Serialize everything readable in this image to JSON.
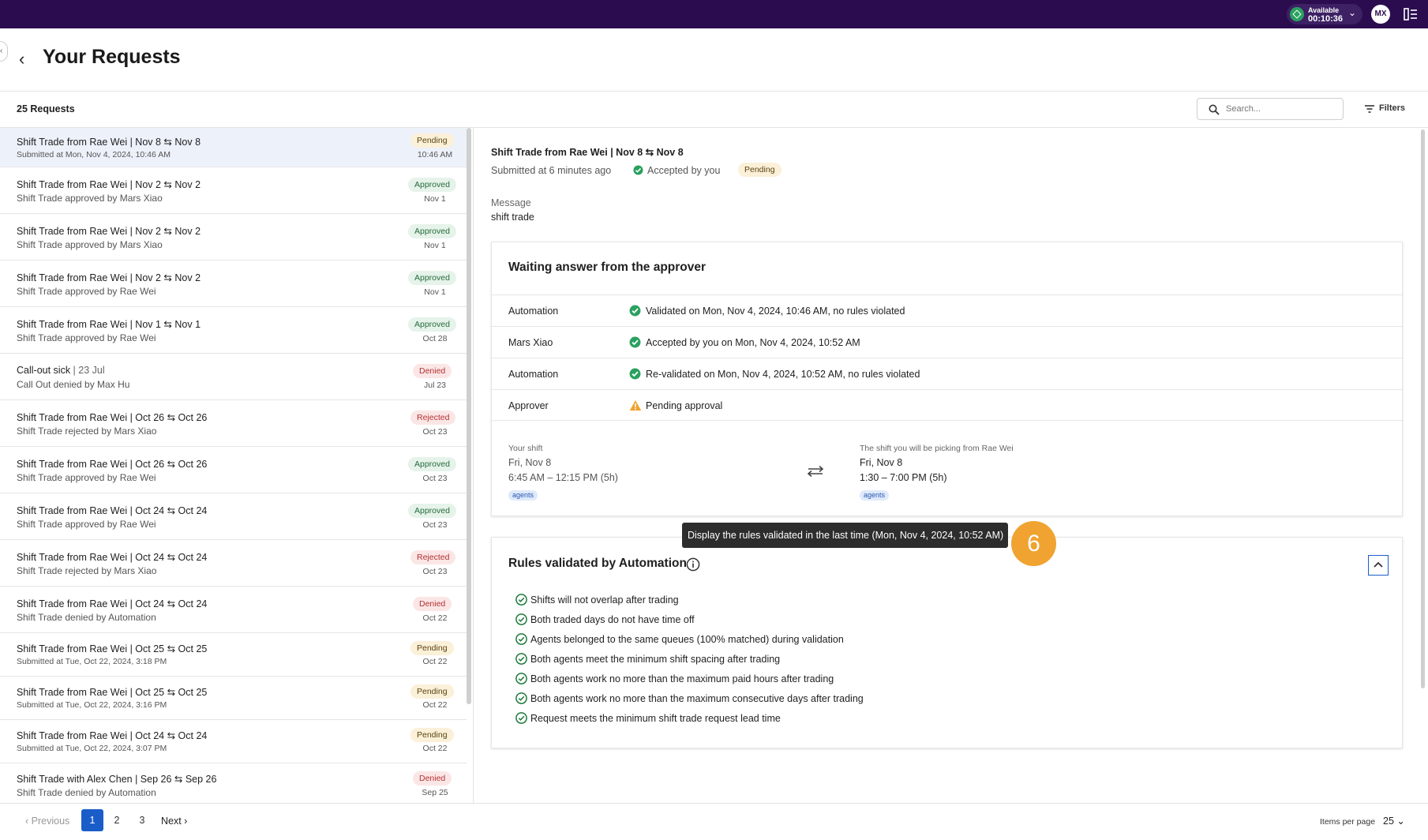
{
  "status": {
    "label": "Available",
    "timer": "00:10:36"
  },
  "user": {
    "initials": "MX"
  },
  "page": {
    "title": "Your Requests"
  },
  "list": {
    "count": "25 Requests",
    "search_placeholder": "Search...",
    "filters_label": "Filters",
    "items": [
      {
        "title": "Shift Trade from Rae Wei | Nov 8 ⇆ Nov 8",
        "subtitle": "Submitted at Mon, Nov 4, 2024, 10:46 AM",
        "status": "Pending",
        "date": "10:46 AM"
      },
      {
        "title": "Shift Trade from Rae Wei | Nov 2 ⇆ Nov 2",
        "subtitle": "Shift Trade approved by Mars Xiao",
        "status": "Approved",
        "date": "Nov 1"
      },
      {
        "title": "Shift Trade from Rae Wei | Nov 2 ⇆ Nov 2",
        "subtitle": "Shift Trade approved by Mars Xiao",
        "status": "Approved",
        "date": "Nov 1"
      },
      {
        "title": "Shift Trade from Rae Wei | Nov 2 ⇆ Nov 2",
        "subtitle": "Shift Trade approved by Rae Wei",
        "status": "Approved",
        "date": "Nov 1"
      },
      {
        "title": "Shift Trade from Rae Wei | Nov 1 ⇆ Nov 1",
        "subtitle": "Shift Trade approved by Rae Wei",
        "status": "Approved",
        "date": "Oct 28"
      },
      {
        "title": "Call-out sick",
        "title_suffix": " | 23 Jul",
        "subtitle": "Call Out denied by Max Hu",
        "status": "Denied",
        "date": "Jul 23"
      },
      {
        "title": "Shift Trade from Rae Wei | Oct 26 ⇆ Oct 26",
        "subtitle": "Shift Trade rejected by Mars Xiao",
        "status": "Rejected",
        "date": "Oct 23"
      },
      {
        "title": "Shift Trade from Rae Wei | Oct 26 ⇆ Oct 26",
        "subtitle": "Shift Trade approved by Rae Wei",
        "status": "Approved",
        "date": "Oct 23"
      },
      {
        "title": "Shift Trade from Rae Wei | Oct 24 ⇆ Oct 24",
        "subtitle": "Shift Trade approved by Rae Wei",
        "status": "Approved",
        "date": "Oct 23"
      },
      {
        "title": "Shift Trade from Rae Wei | Oct 24 ⇆ Oct 24",
        "subtitle": "Shift Trade rejected by Mars Xiao",
        "status": "Rejected",
        "date": "Oct 23"
      },
      {
        "title": "Shift Trade from Rae Wei | Oct 24 ⇆ Oct 24",
        "subtitle": "Shift Trade denied by Automation",
        "status": "Denied",
        "date": "Oct 22"
      },
      {
        "title": "Shift Trade from Rae Wei | Oct 25 ⇆ Oct 25",
        "subtitle": "Submitted at Tue, Oct 22, 2024, 3:18 PM",
        "status": "Pending",
        "date": "Oct 22"
      },
      {
        "title": "Shift Trade from Rae Wei | Oct 25 ⇆ Oct 25",
        "subtitle": "Submitted at Tue, Oct 22, 2024, 3:16 PM",
        "status": "Pending",
        "date": "Oct 22"
      },
      {
        "title": "Shift Trade from Rae Wei | Oct 24 ⇆ Oct 24",
        "subtitle": "Submitted at Tue, Oct 22, 2024, 3:07 PM",
        "status": "Pending",
        "date": "Oct 22"
      },
      {
        "title": "Shift Trade with Alex Chen | Sep 26 ⇆ Sep 26",
        "subtitle": "Shift Trade denied by Automation",
        "status": "Denied",
        "date": "Sep 25"
      }
    ]
  },
  "pagination": {
    "previous": "Previous",
    "pages": [
      "1",
      "2",
      "3"
    ],
    "current": "1",
    "next": "Next",
    "items_per_page_label": "Items per page",
    "items_per_page": "25"
  },
  "detail": {
    "title": "Shift Trade from Rae Wei | Nov 8 ⇆ Nov 8",
    "submitted": "Submitted at 6 minutes ago",
    "accepted": "Accepted by you",
    "status": "Pending",
    "message_label": "Message",
    "message": "shift trade",
    "approval": {
      "title": "Waiting answer from the approver",
      "rows": [
        {
          "actor": "Automation",
          "icon": "check-circle-icon",
          "text": "Validated on Mon, Nov 4, 2024, 10:46 AM, no rules violated"
        },
        {
          "actor": "Mars Xiao",
          "icon": "check-circle-icon",
          "text": "Accepted by you on Mon, Nov 4, 2024, 10:52 AM"
        },
        {
          "actor": "Automation",
          "icon": "check-circle-icon",
          "text": "Re-validated on Mon, Nov 4, 2024, 10:52 AM, no rules violated"
        },
        {
          "actor": "Approver",
          "icon": "warning-icon",
          "text": "Pending approval"
        }
      ],
      "your_shift": {
        "caption": "Your shift",
        "day": "Fri, Nov 8",
        "time": "6:45 AM – 12:15 PM (5h)",
        "tag": "agents"
      },
      "their_shift": {
        "caption": "The shift you will be picking from Rae Wei",
        "day": "Fri, Nov 8",
        "time": "1:30 – 7:00 PM (5h)",
        "tag": "agents"
      }
    },
    "tooltip": "Display the rules validated in the last time (Mon, Nov 4, 2024, 10:52 AM)",
    "step_number": "6",
    "rules": {
      "title": "Rules validated by Automation",
      "items": [
        "Shifts will not overlap after trading",
        "Both traded days do not have time off",
        "Agents belonged to the same queues (100% matched) during validation",
        "Both agents meet the minimum shift spacing after trading",
        "Both agents work no more than the maximum paid hours after trading",
        "Both agents work no more than the maximum consecutive days after trading",
        "Request meets the minimum shift trade request lead time"
      ]
    }
  },
  "colors": {
    "topbar": "#2b0d4f",
    "accent": "#1a5dc8",
    "success": "#2aa15f",
    "warning": "#f0a330"
  }
}
